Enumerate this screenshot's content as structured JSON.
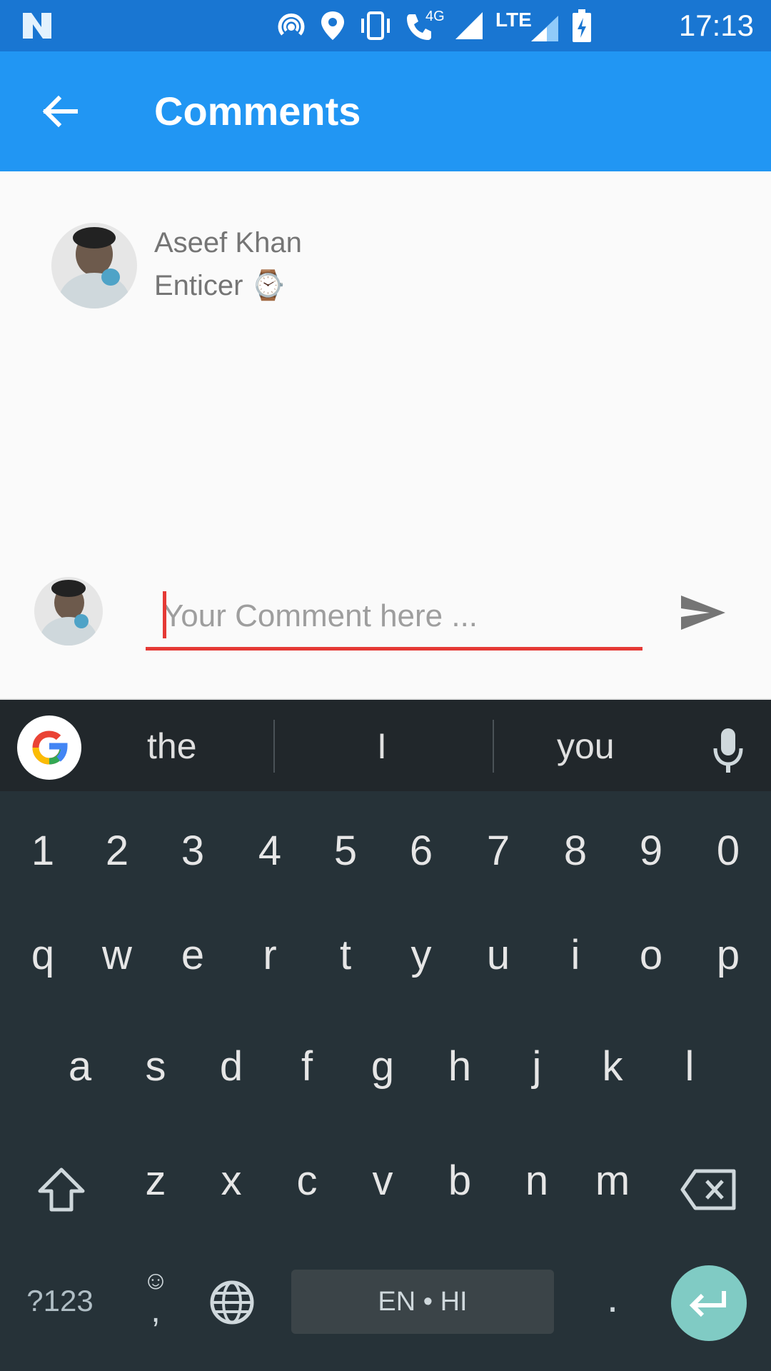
{
  "status_bar": {
    "time": "17:13",
    "network_4g": "4G",
    "network_lte": "LTE",
    "icons": [
      "n-icon",
      "hotspot-icon",
      "location-icon",
      "vibrate-icon",
      "call-icon",
      "signal-icon",
      "lte-signal-icon",
      "battery-icon"
    ]
  },
  "app_bar": {
    "title": "Comments",
    "back_icon": "arrow-back-icon"
  },
  "comment": {
    "user": "Aseef Khan",
    "text": "Enticer",
    "emoji": "⌚"
  },
  "composer": {
    "placeholder": "Your Comment here ...",
    "value": "",
    "send_icon": "send-icon",
    "accent": "#e53935"
  },
  "keyboard": {
    "suggestions": [
      "the",
      "I",
      "you"
    ],
    "row_numbers": [
      "1",
      "2",
      "3",
      "4",
      "5",
      "6",
      "7",
      "8",
      "9",
      "0"
    ],
    "row_q": [
      "q",
      "w",
      "e",
      "r",
      "t",
      "y",
      "u",
      "i",
      "o",
      "p"
    ],
    "row_a": [
      "a",
      "s",
      "d",
      "f",
      "g",
      "h",
      "j",
      "k",
      "l"
    ],
    "row_z": [
      "z",
      "x",
      "c",
      "v",
      "b",
      "n",
      "m"
    ],
    "symbols_key": "?123",
    "emoji_key": "☺",
    "comma_key": ",",
    "period_key": ".",
    "space_label": "EN • HI"
  },
  "colors": {
    "status": "#1976d2",
    "appbar": "#2196f3",
    "enter": "#80cbc4"
  }
}
